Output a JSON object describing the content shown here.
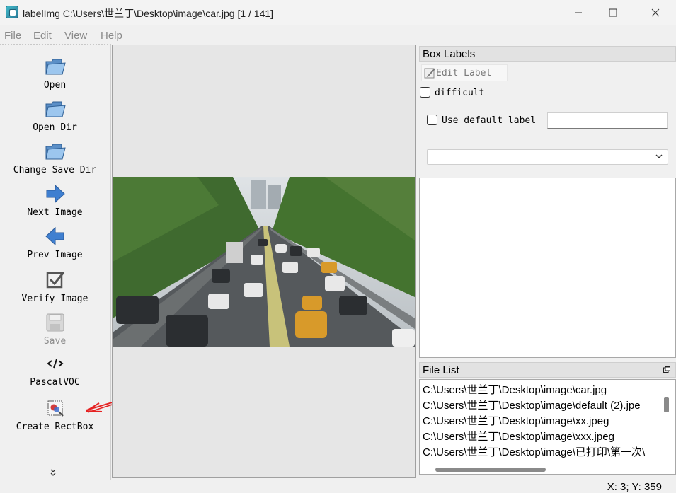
{
  "window": {
    "title": "labelImg C:\\Users\\世兰丁\\Desktop\\image\\car.jpg [1 / 141]",
    "app_icon": "labelimg-app-icon",
    "controls": [
      "minimize-icon",
      "maximize-icon",
      "close-icon"
    ]
  },
  "menu": [
    "File",
    "Edit",
    "View",
    "Help"
  ],
  "toolbar": {
    "items": [
      {
        "label": "Open",
        "icon": "folder-icon",
        "enabled": true
      },
      {
        "label": "Open Dir",
        "icon": "folder-icon",
        "enabled": true
      },
      {
        "label": "Change Save Dir",
        "icon": "folder-icon",
        "enabled": true
      },
      {
        "label": "Next Image",
        "icon": "arrow-right-icon",
        "enabled": true
      },
      {
        "label": "Prev Image",
        "icon": "arrow-left-icon",
        "enabled": true
      },
      {
        "label": "Verify Image",
        "icon": "checkbox-check-icon",
        "enabled": true
      },
      {
        "label": "Save",
        "icon": "save-icon",
        "enabled": false
      },
      {
        "label": "PascalVOC",
        "icon": "code-icon",
        "enabled": true
      },
      {
        "label": "Create RectBox",
        "icon": "rectbox-icon",
        "enabled": true
      }
    ],
    "more_icon": "chevron-double-down-icon"
  },
  "box_labels": {
    "title": "Box Labels",
    "edit_label": "Edit Label",
    "difficult": {
      "label": "difficult",
      "checked": false
    },
    "use_default_label": {
      "label": "Use default label",
      "checked": false
    },
    "default_label_value": "",
    "label_combo_value": ""
  },
  "file_list": {
    "title": "File List",
    "items": [
      "C:\\Users\\世兰丁\\Desktop\\image\\car.jpg",
      "C:\\Users\\世兰丁\\Desktop\\image\\default (2).jpe",
      "C:\\Users\\世兰丁\\Desktop\\image\\xx.jpeg",
      "C:\\Users\\世兰丁\\Desktop\\image\\xxx.jpeg",
      "C:\\Users\\世兰丁\\Desktop\\image\\已打印\\第一次\\"
    ]
  },
  "status": "X: 3; Y: 359",
  "colors": {
    "annotation_arrow": "#e52222",
    "arrow_icon_blue": "#3f7fd0"
  }
}
